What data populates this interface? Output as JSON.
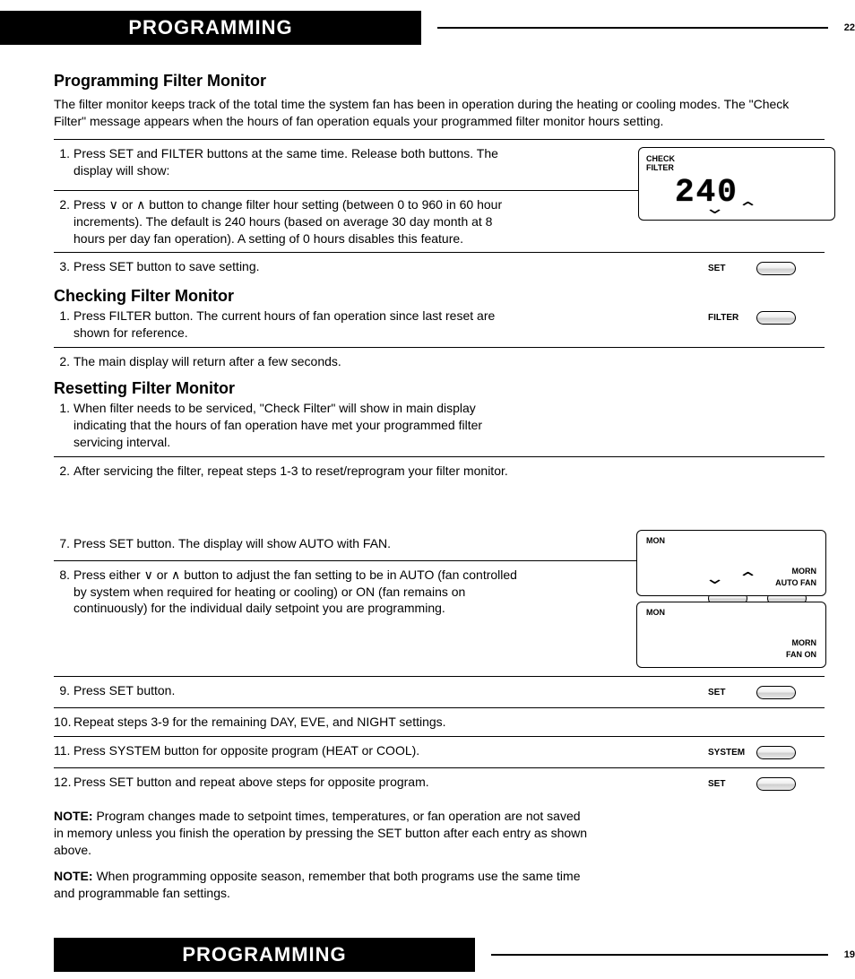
{
  "header": {
    "title": "PROGRAMMING",
    "pageNum": "22"
  },
  "footer": {
    "title": "PROGRAMMING",
    "pageNum": "19"
  },
  "sec1": {
    "title": "Programming Filter Monitor",
    "intro": "The filter monitor keeps track of the total time the system fan has been in operation during the heating or cooling modes. The \"Check Filter\" message appears when the hours of fan operation equals your programmed filter monitor hours setting.",
    "steps": [
      {
        "n": "1.",
        "t": "Press SET and FILTER buttons at the same time. Release both buttons. The display will show:",
        "btns": [
          "SET",
          "FILTER"
        ]
      },
      {
        "n": "2.",
        "t": "Press ∨ or ∧ button to change filter hour setting (between 0 to 960 in 60 hour increments). The default is 240 hours (based on average 30 day month at 8 hours per day fan operation). A setting of 0 hours disables this feature.",
        "arrows": true
      },
      {
        "n": "3.",
        "t": "Press SET button to save setting.",
        "btns": [
          "SET"
        ]
      }
    ]
  },
  "sec2": {
    "title": "Checking Filter Monitor",
    "steps": [
      {
        "n": "1.",
        "t": "Press FILTER button.  The current hours of fan operation since last reset are shown for reference.",
        "btns": [
          "FILTER"
        ]
      },
      {
        "n": "2.",
        "t": "The main display will return after a few seconds."
      }
    ]
  },
  "sec3": {
    "title": "Resetting Filter Monitor",
    "steps": [
      {
        "n": "1.",
        "t": "When filter needs to be serviced, \"Check Filter\" will show in main display indicating that the hours of fan operation have met your programmed filter servicing interval."
      },
      {
        "n": "2.",
        "t": "After servicing the filter, repeat steps 1-3 to reset/reprogram your filter monitor."
      }
    ]
  },
  "lower": {
    "steps": [
      {
        "n": "7.",
        "t": "Press SET button.  The display will show AUTO with FAN.",
        "btns": [
          "SET"
        ]
      },
      {
        "n": "8.",
        "t": "Press either ∨ or ∧ button to adjust the fan setting to be in AUTO (fan controlled by system when required for heating or cooling) or ON (fan remains on continuously) for the individual daily setpoint you are programming.",
        "arrows": true,
        "ovals": true
      },
      {
        "n": "9.",
        "t": "Press SET button.",
        "btns": [
          "SET"
        ]
      },
      {
        "n": "10.",
        "t": "Repeat steps 3-9 for the remaining DAY, EVE, and NIGHT settings."
      },
      {
        "n": "11.",
        "t": "Press SYSTEM button for opposite program (HEAT or COOL).",
        "btns": [
          "SYSTEM"
        ]
      },
      {
        "n": "12.",
        "t": "Press SET button and repeat above steps for opposite program.",
        "btns": [
          "SET"
        ]
      }
    ],
    "note1_label": "NOTE:",
    "note1": "Program changes made to setpoint times, temperatures, or fan operation are not saved in memory unless you finish the operation by pressing the SET button after each entry as shown above.",
    "note2_label": "NOTE:",
    "note2": "When programming opposite season, remember that both programs use the same time and programmable fan settings."
  },
  "display1": {
    "check": "CHECK",
    "filter": "FILTER",
    "value": "240"
  },
  "display2": {
    "mon": "MON",
    "morn": "MORN",
    "mode": "AUTO FAN"
  },
  "display3": {
    "mon": "MON",
    "morn": "MORN",
    "mode": "FAN ON"
  }
}
